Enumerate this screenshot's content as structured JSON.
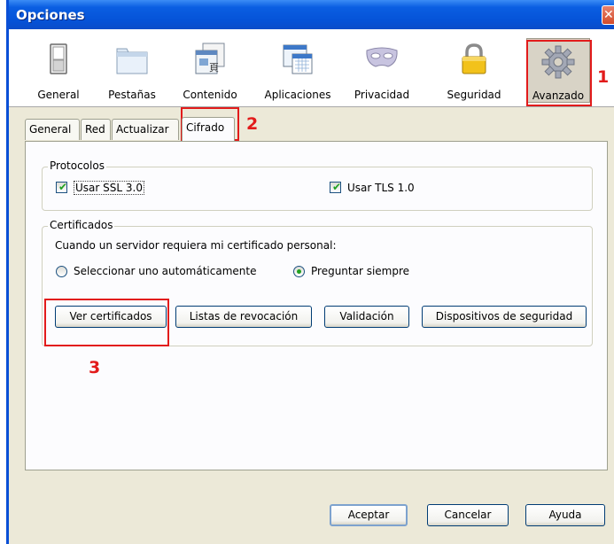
{
  "window": {
    "title": "Opciones",
    "close_glyph": "✕"
  },
  "toolbar": {
    "panes": [
      {
        "label": "General",
        "icon": "switch-icon"
      },
      {
        "label": "Pestañas",
        "icon": "tabs-icon"
      },
      {
        "label": "Contenido",
        "icon": "content-icon"
      },
      {
        "label": "Aplicaciones",
        "icon": "applications-icon"
      },
      {
        "label": "Privacidad",
        "icon": "mask-icon"
      },
      {
        "label": "Seguridad",
        "icon": "lock-icon"
      },
      {
        "label": "Avanzado",
        "icon": "gear-icon"
      }
    ],
    "selected": "Avanzado"
  },
  "annotations": {
    "step1": "1",
    "step2": "2",
    "step3": "3",
    "color": "#e21b1b"
  },
  "tabs": [
    {
      "label": "General"
    },
    {
      "label": "Red"
    },
    {
      "label": "Actualizar"
    },
    {
      "label": "Cifrado"
    }
  ],
  "active_tab": "Cifrado",
  "protocolos": {
    "title": "Protocolos",
    "ssl_label": "Usar SSL 3.0",
    "ssl_checked": true,
    "tls_label": "Usar TLS 1.0",
    "tls_checked": true
  },
  "certificados": {
    "title": "Certificados",
    "prompt": "Cuando un servidor requiera mi certificado personal:",
    "option_auto": "Seleccionar uno automáticamente",
    "option_ask": "Preguntar siempre",
    "selected_option": "Preguntar siempre",
    "buttons": {
      "ver": "Ver certificados",
      "revocacion": "Listas de revocación",
      "validacion": "Validación",
      "dispositivos": "Dispositivos de seguridad"
    }
  },
  "footer": {
    "aceptar": "Aceptar",
    "cancelar": "Cancelar",
    "ayuda": "Ayuda"
  },
  "colors": {
    "titlebar": "#0553d8",
    "dialog_bg": "#ece9d8",
    "check_green": "#21a121"
  }
}
